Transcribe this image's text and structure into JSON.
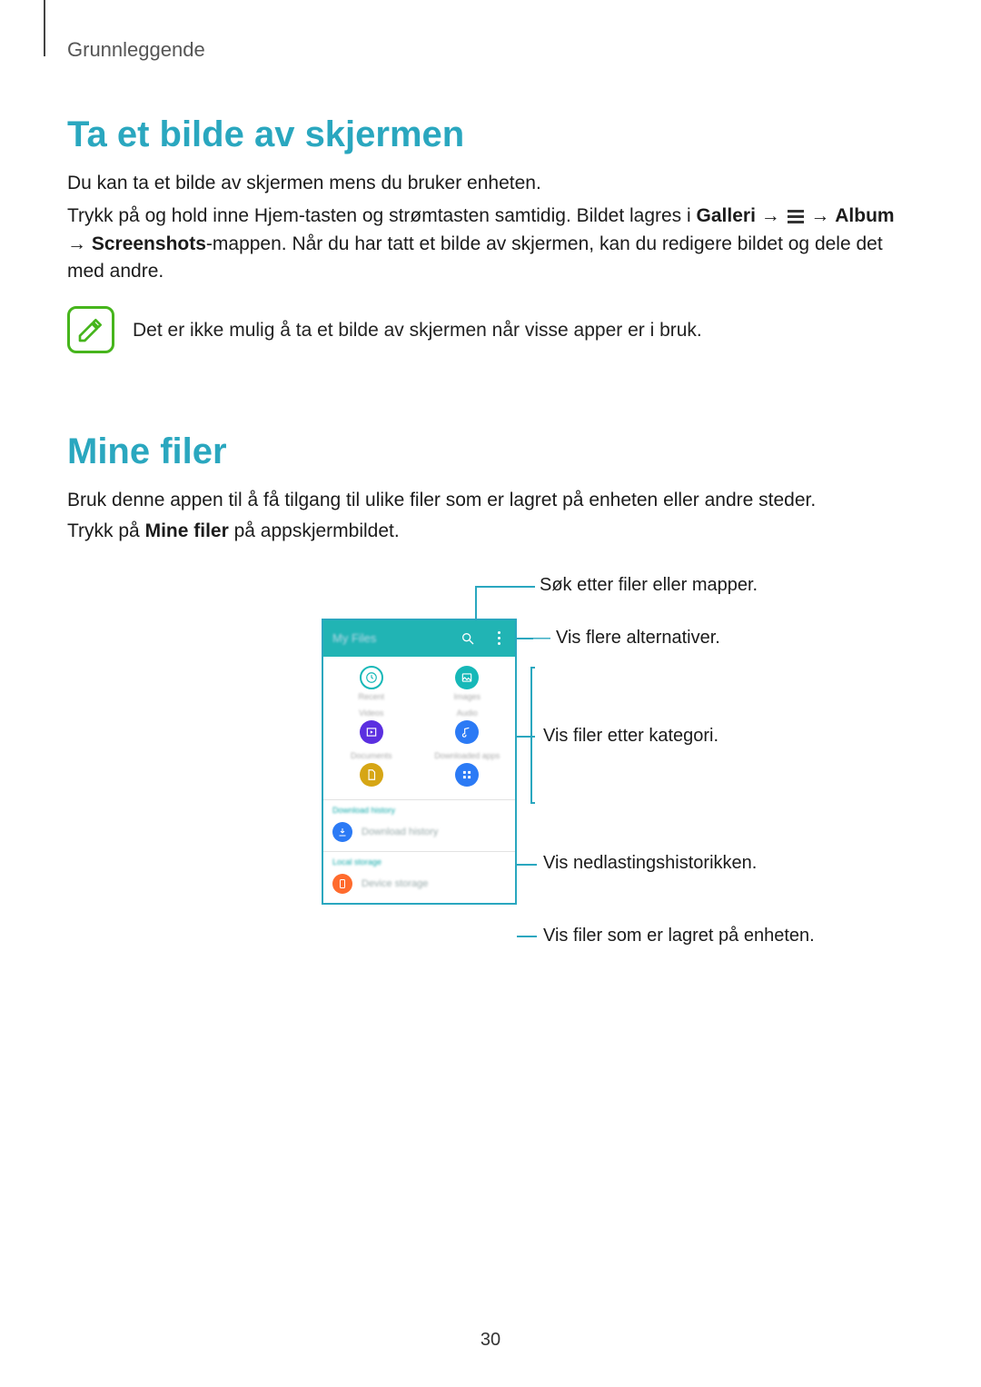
{
  "header": {
    "section": "Grunnleggende"
  },
  "screenshot_section": {
    "heading": "Ta et bilde av skjermen",
    "p1": "Du kan ta et bilde av skjermen mens du bruker enheten.",
    "p2_pre": "Trykk på og hold inne Hjem-tasten og strømtasten samtidig. Bildet lagres i ",
    "p2_b1": "Galleri",
    "p2_mid1": " → ",
    "p2_mid2": " → ",
    "p2_b2": "Album",
    "p2_mid3": " → ",
    "p2_b3": "Screenshots",
    "p2_post": "-mappen. Når du har tatt et bilde av skjermen, kan du redigere bildet og dele det med andre.",
    "note": "Det er ikke mulig å ta et bilde av skjermen når visse apper er i bruk."
  },
  "myfiles_section": {
    "heading": "Mine filer",
    "p1": "Bruk denne appen til å få tilgang til ulike filer som er lagret på enheten eller andre steder.",
    "p2_pre": "Trykk på ",
    "p2_b": "Mine filer",
    "p2_post": " på appskjermbildet."
  },
  "callouts": {
    "search": "Søk etter filer eller mapper.",
    "more": "Vis flere alternativer.",
    "category": "Vis filer etter kategori.",
    "downloads": "Vis nedlastingshistorikken.",
    "device": "Vis filer som er lagret på enheten."
  },
  "phone_ui": {
    "title": "My Files",
    "cat_recent": "Recent",
    "cat_images": "Images",
    "cat_videos": "Videos",
    "cat_audio": "Audio",
    "cat_docs": "Documents",
    "cat_dlapps": "Downloaded apps",
    "sec_dlhist": "Download history",
    "item_dlhist": "Download history",
    "sec_local": "Local storage",
    "item_device": "Device storage"
  },
  "page_number": "30"
}
